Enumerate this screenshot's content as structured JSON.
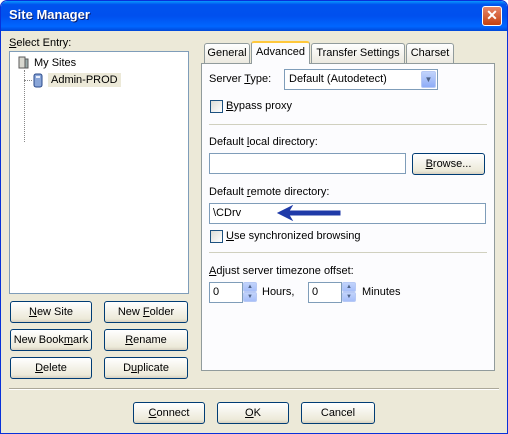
{
  "window": {
    "title": "Site Manager",
    "close_glyph": "✕"
  },
  "left": {
    "select_entry_prefix": "",
    "select_entry_underline": "S",
    "select_entry_rest": "elect Entry:",
    "tree": {
      "root": "My Sites",
      "child": "Admin-PROD"
    }
  },
  "left_buttons": {
    "new_site": {
      "pre": "",
      "ul": "N",
      "post": "ew Site"
    },
    "new_folder": {
      "pre": "New ",
      "ul": "F",
      "post": "older"
    },
    "new_bookmark": {
      "pre": "New Book",
      "ul": "m",
      "post": "ark"
    },
    "rename": {
      "pre": "",
      "ul": "R",
      "post": "ename"
    },
    "delete": {
      "pre": "",
      "ul": "D",
      "post": "elete"
    },
    "duplicate": {
      "pre": "D",
      "ul": "u",
      "post": "plicate"
    }
  },
  "tabs": [
    "General",
    "Advanced",
    "Transfer Settings",
    "Charset"
  ],
  "advanced": {
    "server_type_label": {
      "pre": "Server ",
      "ul": "T",
      "post": "ype:"
    },
    "server_type_value": "Default (Autodetect)",
    "bypass_proxy": {
      "pre": "",
      "ul": "B",
      "post": "ypass proxy"
    },
    "local_dir_label": {
      "pre": "Default ",
      "ul": "l",
      "post": "ocal directory:"
    },
    "local_dir_value": "",
    "browse": {
      "pre": "",
      "ul": "B",
      "post": "rowse..."
    },
    "remote_dir_label": {
      "pre": "Default ",
      "ul": "r",
      "post": "emote directory:"
    },
    "remote_dir_value": "\\CDrv",
    "sync_browsing": {
      "pre": "",
      "ul": "U",
      "post": "se synchronized browsing"
    },
    "timezone_label": {
      "pre": "",
      "ul": "A",
      "post": "djust server timezone offset:"
    },
    "hours_value": "0",
    "hours_label": "Hours,",
    "minutes_value": "0",
    "minutes_label": "Minutes"
  },
  "footer": {
    "connect": {
      "pre": "",
      "ul": "C",
      "post": "onnect"
    },
    "ok": {
      "pre": "",
      "ul": "O",
      "post": "K"
    },
    "cancel": {
      "pre": "Cancel",
      "ul": "",
      "post": ""
    }
  },
  "colors": {
    "title_bar": "#0053ee",
    "arrow": "#1f3aa8",
    "close": "#c4410f"
  }
}
